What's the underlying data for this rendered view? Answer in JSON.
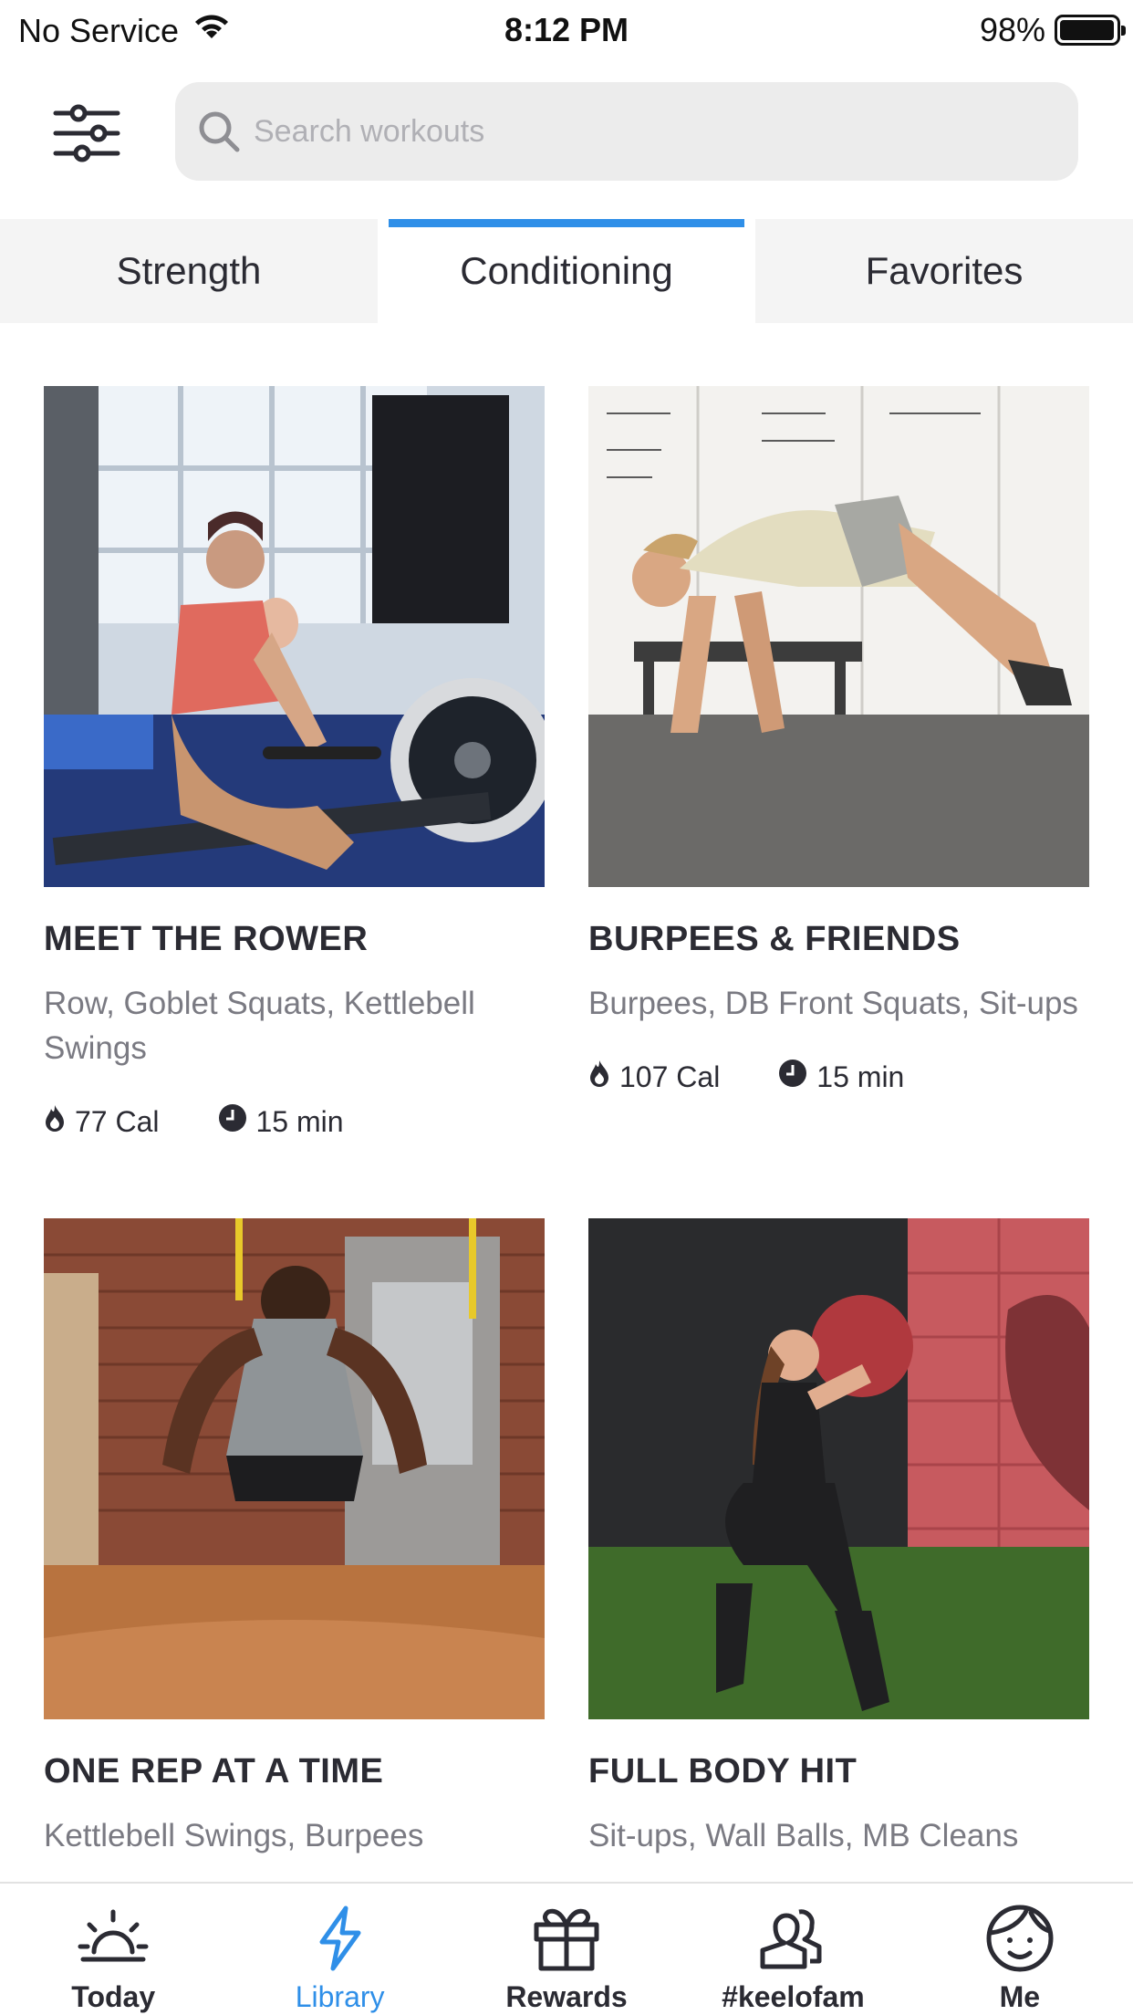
{
  "status_bar": {
    "carrier": "No Service",
    "time": "8:12 PM",
    "battery": "98%",
    "battery_level": 0.98
  },
  "search": {
    "placeholder": "Search workouts",
    "value": ""
  },
  "tabs": [
    {
      "label": "Strength",
      "active": false
    },
    {
      "label": "Conditioning",
      "active": true
    },
    {
      "label": "Favorites",
      "active": false
    }
  ],
  "workouts": [
    {
      "title": "MEET THE ROWER",
      "exercises": "Row, Goblet Squats, Kettlebell Swings",
      "calories": "77 Cal",
      "duration": "15 min"
    },
    {
      "title": "BURPEES & FRIENDS",
      "exercises": "Burpees, DB Front Squats, Sit-ups",
      "calories": "107 Cal",
      "duration": "15 min"
    },
    {
      "title": "ONE REP AT A TIME",
      "exercises": "Kettlebell Swings, Burpees",
      "calories": "",
      "duration": ""
    },
    {
      "title": "FULL BODY HIT",
      "exercises": "Sit-ups, Wall Balls, MB Cleans",
      "calories": "",
      "duration": ""
    }
  ],
  "bottom_nav": [
    {
      "label": "Today",
      "icon": "sun-icon",
      "active": false
    },
    {
      "label": "Library",
      "icon": "lightning-icon",
      "active": true
    },
    {
      "label": "Rewards",
      "icon": "gift-icon",
      "active": false
    },
    {
      "label": "#keelofam",
      "icon": "people-icon",
      "active": false
    },
    {
      "label": "Me",
      "icon": "face-icon",
      "active": false
    }
  ],
  "colors": {
    "accent": "#2f8fe8",
    "text_dark": "#2b2b33",
    "text_muted": "#7a7a82",
    "search_bg": "#ececec",
    "tab_inactive_bg": "#f4f4f4"
  }
}
